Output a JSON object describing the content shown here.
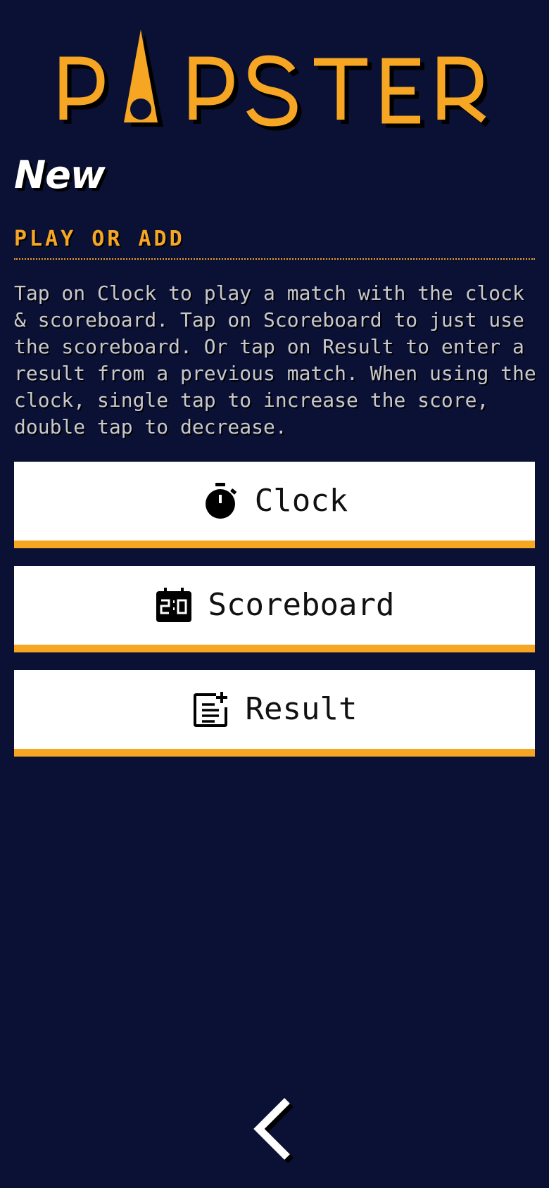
{
  "app": {
    "logo_text": "PAPSTER"
  },
  "colors": {
    "background": "#0b1135",
    "accent": "#f6a623",
    "text_light": "#c8c8cc",
    "heading": "#ffffff",
    "button_bg": "#ffffff"
  },
  "page": {
    "heading": "New",
    "subheading": "PLAY OR ADD",
    "description": "Tap on Clock to play a match with the clock & scoreboard. Tap on Scoreboard to just use the scoreboard. Or tap on Result to enter a result from a previous match. When using the clock, single tap to increase the score, double tap to decrease."
  },
  "buttons": {
    "clock": {
      "label": "Clock",
      "icon": "stopwatch-icon"
    },
    "scoreboard": {
      "label": "Scoreboard",
      "icon": "scoreboard-icon"
    },
    "result": {
      "label": "Result",
      "icon": "add-result-icon"
    }
  },
  "navigation": {
    "back_icon": "chevron-left-icon"
  }
}
